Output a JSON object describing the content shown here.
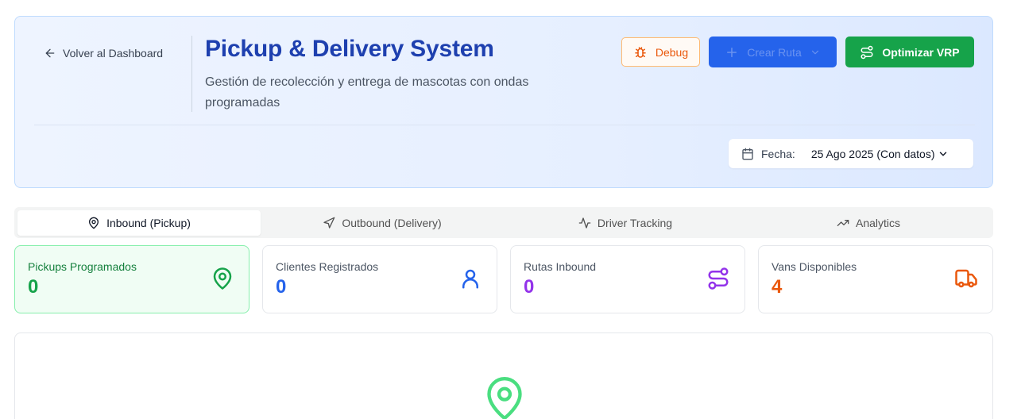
{
  "header": {
    "back_label": "Volver al Dashboard",
    "title": "Pickup & Delivery System",
    "subtitle": "Gestión de recolección y entrega de mascotas con ondas programadas"
  },
  "actions": {
    "debug_label": "Debug",
    "crear_ruta_label": "Crear Ruta",
    "optimizar_label": "Optimizar VRP"
  },
  "date_filter": {
    "label": "Fecha:",
    "value": "25 Ago 2025 (Con datos)"
  },
  "tabs": [
    {
      "label": "Inbound (Pickup)",
      "icon": "map-pin-icon",
      "active": true
    },
    {
      "label": "Outbound (Delivery)",
      "icon": "send-icon",
      "active": false
    },
    {
      "label": "Driver Tracking",
      "icon": "activity-icon",
      "active": false
    },
    {
      "label": "Analytics",
      "icon": "trending-up-icon",
      "active": false
    }
  ],
  "stats": [
    {
      "label": "Pickups Programados",
      "value": "0",
      "icon": "map-pin-icon",
      "color": "#16a34a"
    },
    {
      "label": "Clientes Registrados",
      "value": "0",
      "icon": "user-icon",
      "color": "#2563eb"
    },
    {
      "label": "Rutas Inbound",
      "value": "0",
      "icon": "route-icon",
      "color": "#9333ea"
    },
    {
      "label": "Vans Disponibles",
      "value": "4",
      "icon": "truck-icon",
      "color": "#ea580c"
    }
  ],
  "colors": {
    "primary": "#1e40af",
    "success": "#16a34a",
    "warning": "#ea580c",
    "info": "#2563eb"
  }
}
